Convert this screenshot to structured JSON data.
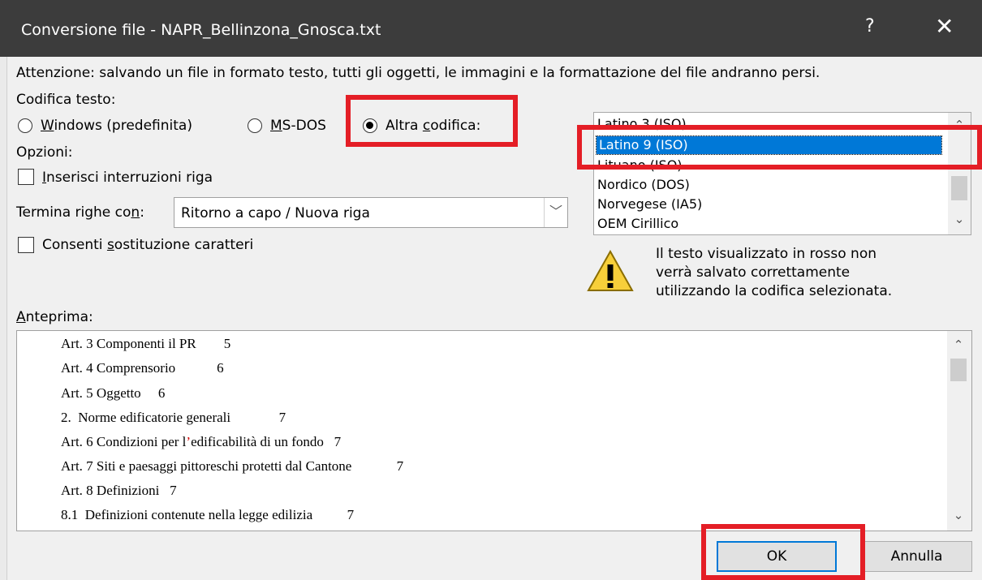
{
  "window": {
    "title": "Conversione file - NAPR_Bellinzona_Gnosca.txt",
    "help_label": "?",
    "close_label": "✕"
  },
  "warning_text": "Attenzione: salvando un file in formato testo, tutti gli oggetti, le immagini e la formattazione del file andranno persi.",
  "encoding": {
    "label": "Codifica testo:",
    "options": [
      {
        "label": "Windows (predefinita)",
        "accel": "W",
        "rest": "indows (predefinita)",
        "checked": false
      },
      {
        "label": "MS-DOS",
        "accel": "M",
        "rest": "S-DOS",
        "checked": false
      },
      {
        "label": "Altra codifica:",
        "pre": "Altra ",
        "accel": "c",
        "rest": "odifica:",
        "checked": true
      }
    ]
  },
  "options": {
    "label": "Opzioni:",
    "insert_breaks": {
      "accel": "I",
      "rest": "nserisci interruzioni riga",
      "checked": false
    },
    "line_end": {
      "pre": "Termina righe co",
      "accel": "n",
      "rest": ":",
      "value": "Ritorno a capo / Nuova riga"
    },
    "allow_sub": {
      "pre": "Consenti ",
      "accel": "s",
      "rest": "ostituzione caratteri",
      "checked": false
    }
  },
  "encoding_list": {
    "items": [
      "Latino 3 (ISO)",
      "Latino 9 (ISO)",
      "Lituano (ISO)",
      "Nordico (DOS)",
      "Norvegese (IA5)",
      "OEM Cirillico"
    ],
    "selected": "Latino 9 (ISO)"
  },
  "notice": {
    "line1": "Il testo visualizzato in rosso non",
    "line2": "verrà salvato correttamente",
    "line3": "utilizzando la codifica selezionata.",
    "icon": "warning-icon"
  },
  "preview": {
    "accel": "A",
    "rest": "nteprima:",
    "lines": [
      "Art. 3 Componenti il PR        5",
      "Art. 4 Comprensorio            6",
      "Art. 5 Oggetto     6",
      "2.  Norme edificatorie generali              7",
      {
        "pre": "Art. 6 Condizioni per l",
        "red": "’",
        "post": "edificabilità di un fondo   7"
      },
      "Art. 7 Siti e paesaggi pittoreschi protetti dal Cantone             7",
      "Art. 8 Definizioni   7",
      "8.1  Definizioni contenute nella legge edilizia          7"
    ]
  },
  "buttons": {
    "ok": "OK",
    "cancel": "Annulla"
  },
  "colors": {
    "titlebar": "#3c3c3c",
    "selection": "#0078d7",
    "highlight": "#e41e26",
    "invalid_char": "#d00000"
  }
}
